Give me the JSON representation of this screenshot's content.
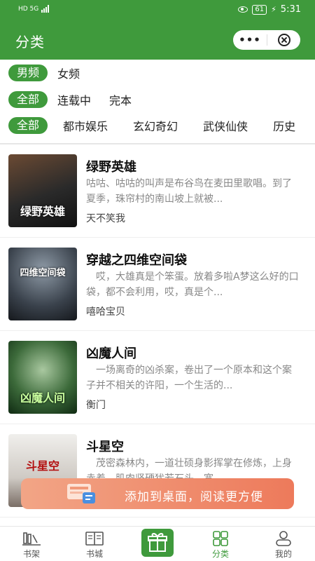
{
  "status_bar": {
    "left": "HD 5G",
    "battery": "61",
    "time": "5:31"
  },
  "app_bar": {
    "title": "分类",
    "more_label": "•••"
  },
  "filters": {
    "gender": {
      "active": "男频",
      "options": [
        "女频"
      ]
    },
    "status": {
      "active": "全部",
      "options": [
        "连载中",
        "完本"
      ]
    },
    "genre": {
      "active": "全部",
      "options": [
        "都市娱乐",
        "玄幻奇幻",
        "武侠仙侠",
        "历史"
      ]
    }
  },
  "books": [
    {
      "title": "绿野英雄",
      "desc": "咕咕、咕咕的叫声是布谷鸟在麦田里歌唱。到了夏季，珠帘村的南山坡上就被...",
      "author": "天不笑我",
      "cover_text": "绿野英雄"
    },
    {
      "title": "穿越之四维空间袋",
      "desc": "　哎，大雄真是个笨蛋。放着多啦A梦这么好的口袋，都不会利用，哎，真是个...",
      "author": "嘻哈宝贝",
      "cover_text": "四维空间袋"
    },
    {
      "title": "凶魔人间",
      "desc": "　一场离奇的凶杀案，卷出了一个原本和这个案子并不相关的许阳，一个生活的...",
      "author": "衡门",
      "cover_text": "凶魔人间"
    },
    {
      "title": "斗星空",
      "desc": "　茂密森林内，一道壮硕身影挥掌在修炼，上身赤着，肌肉坚硬犹若石头，宽...",
      "author": "",
      "cover_text": "斗星空"
    }
  ],
  "toast": {
    "text": "添加到桌面，阅读更方便"
  },
  "tabs": [
    {
      "label": "书架",
      "icon": "bookshelf-icon"
    },
    {
      "label": "书城",
      "icon": "open-book-icon"
    },
    {
      "label": "",
      "icon": "gift-icon"
    },
    {
      "label": "分类",
      "icon": "grid-icon"
    },
    {
      "label": "我的",
      "icon": "user-icon"
    }
  ],
  "colors": {
    "brand": "#3f9a3c",
    "toast": "#ed7a5b"
  }
}
